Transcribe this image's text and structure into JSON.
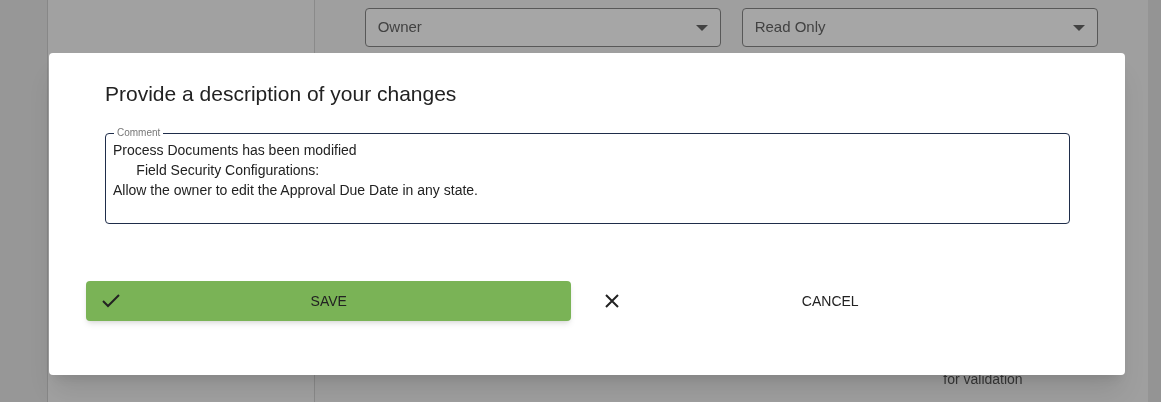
{
  "background": {
    "dropdowns": [
      {
        "value": "Owner"
      },
      {
        "value": "Read Only"
      }
    ],
    "note": "for validation"
  },
  "dialog": {
    "title": "Provide a description of your changes",
    "comment": {
      "label": "Comment",
      "value": "Process Documents has been modified\n\tField Security Configurations:\nAllow the owner to edit the Approval Due Date in any state."
    },
    "buttons": [
      {
        "kind": "save",
        "label": "SAVE"
      },
      {
        "kind": "cancel",
        "label": "CANCEL"
      }
    ]
  }
}
